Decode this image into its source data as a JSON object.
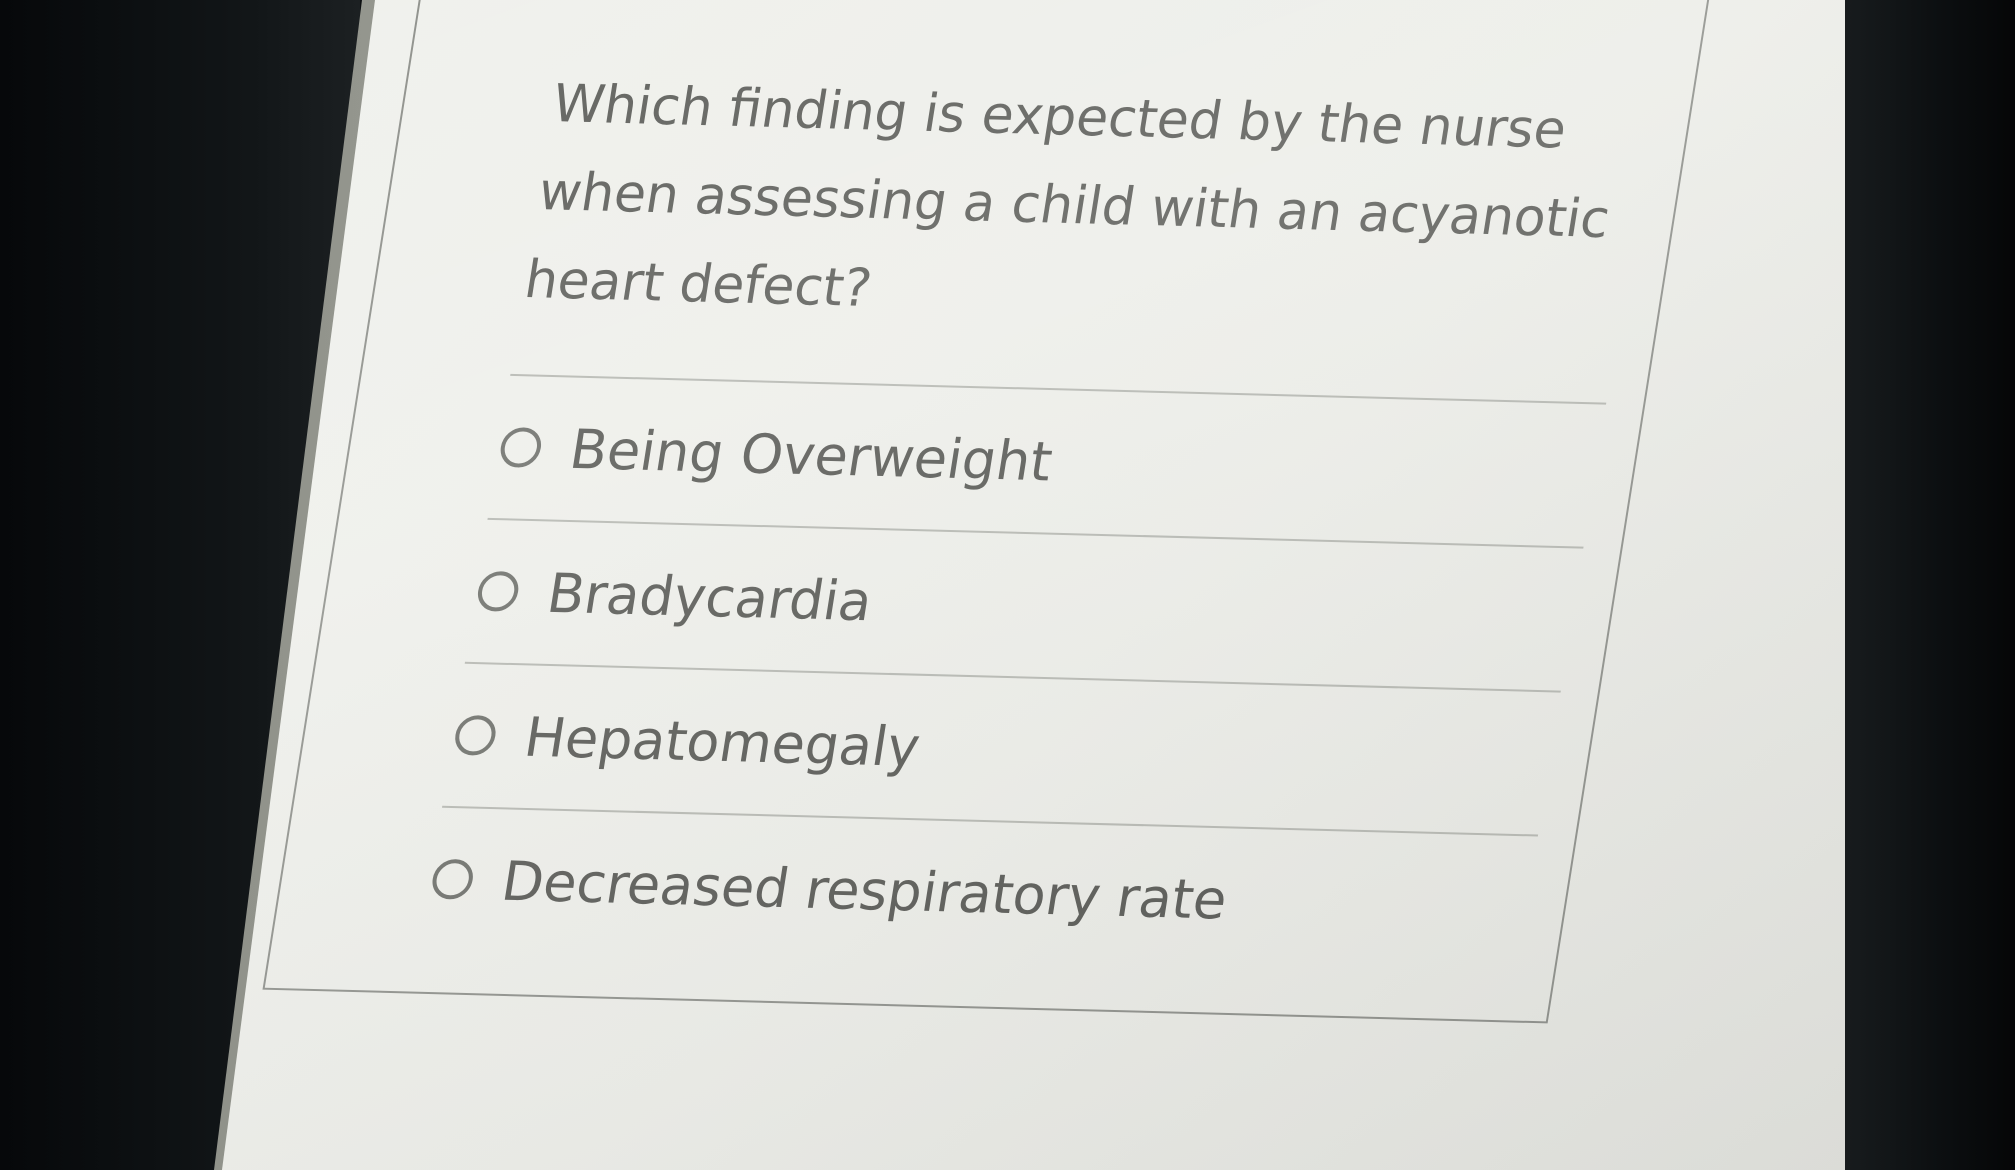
{
  "question": {
    "text": "Which finding is expected by the nurse when assessing a child with an acyanotic heart defect?"
  },
  "options": [
    {
      "label": "Being Overweight",
      "selected": false
    },
    {
      "label": "Bradycardia",
      "selected": false
    },
    {
      "label": "Hepatomegaly",
      "selected": false
    },
    {
      "label": "Decreased respiratory rate",
      "selected": false
    }
  ]
}
